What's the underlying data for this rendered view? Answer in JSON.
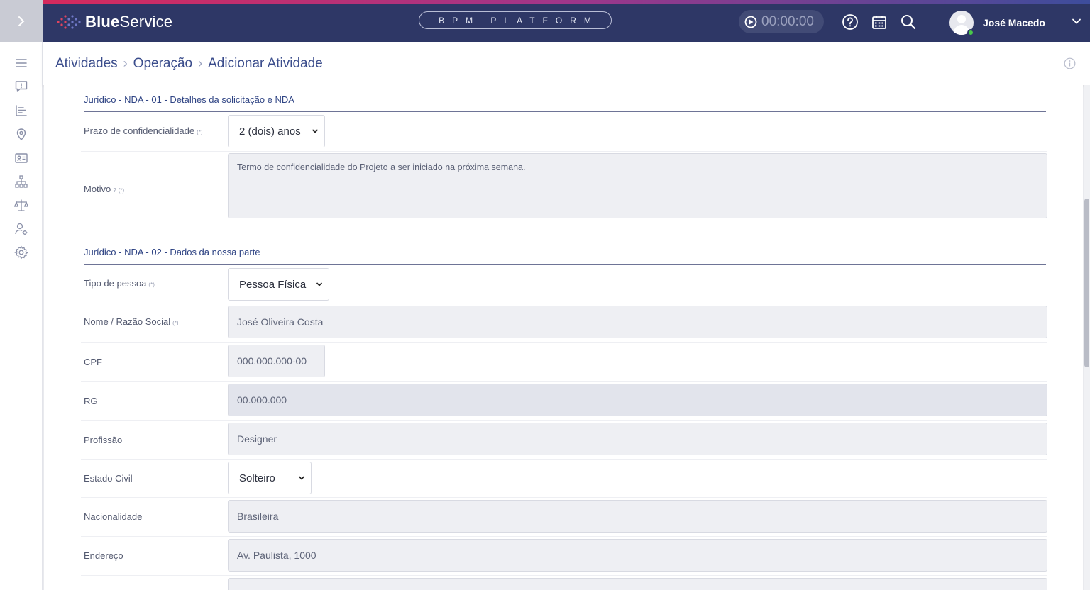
{
  "app": {
    "brand_bold": "Blue",
    "brand_regular": "Service",
    "platform_label": "BPM PLATFORM",
    "timer": "00:00:00",
    "user_name": "José Macedo"
  },
  "breadcrumb": [
    "Atividades",
    "Operação",
    "Adicionar Atividade"
  ],
  "sidebar": {
    "icons": [
      "menu-icon",
      "message-alert-icon",
      "list-chart-icon",
      "location-pin-icon",
      "id-card-icon",
      "org-chart-icon",
      "scale-icon",
      "user-settings-icon",
      "gear-icon"
    ]
  },
  "sections": [
    {
      "title": "Jurídico - NDA - 01 - Detalhes da solicitação e NDA",
      "fields": [
        {
          "label": "Prazo de confidencialidade",
          "required_mark": "(*)",
          "value": "2 (dois) anos"
        },
        {
          "label": "Motivo",
          "help_mark": "?",
          "required_mark": "(*)",
          "value": "Termo de confidencialidade do Projeto a ser iniciado na próxima semana."
        }
      ]
    },
    {
      "title": "Jurídico - NDA - 02 - Dados da nossa parte",
      "fields": [
        {
          "label": "Tipo de pessoa",
          "required_mark": "(*)",
          "value": "Pessoa Física"
        },
        {
          "label": "Nome / Razão Social",
          "required_mark": "(*)",
          "value": "José Oliveira Costa"
        },
        {
          "label": "CPF",
          "value": "000.000.000-00"
        },
        {
          "label": "RG",
          "value": "00.000.000"
        },
        {
          "label": "Profissão",
          "value": "Designer"
        },
        {
          "label": "Estado Civil",
          "value": "Solteiro"
        },
        {
          "label": "Nacionalidade",
          "value": "Brasileira"
        },
        {
          "label": "Endereço",
          "value": "Av. Paulista, 1000"
        }
      ]
    }
  ]
}
